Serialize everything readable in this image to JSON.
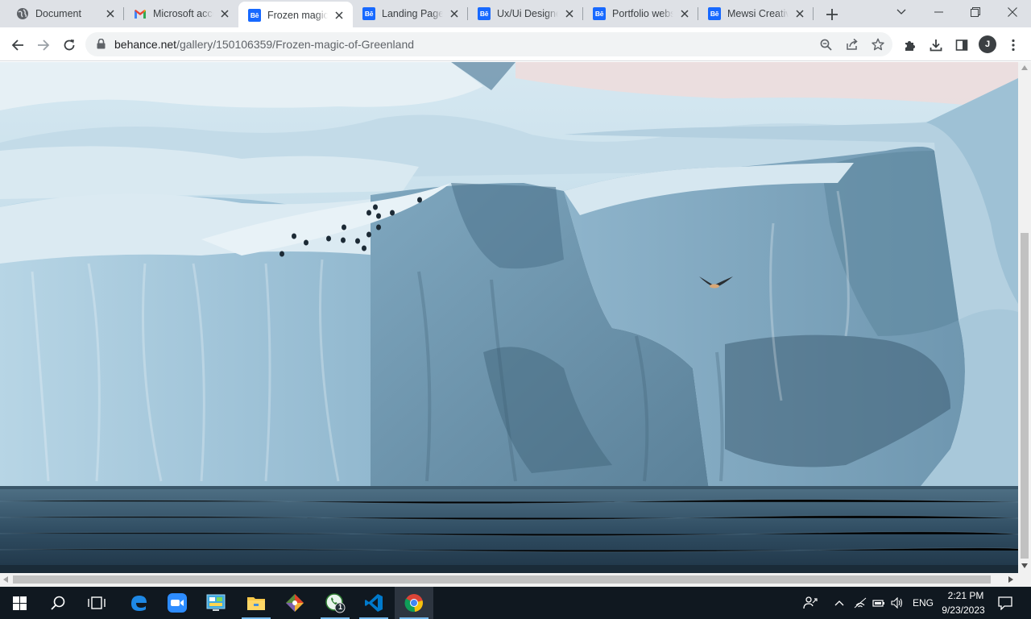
{
  "browser": {
    "tabs": [
      {
        "title": "Document",
        "icon": "globe-icon",
        "active": false
      },
      {
        "title": "Microsoft acco",
        "icon": "gmail-icon",
        "active": false
      },
      {
        "title": "Frozen magic o",
        "icon": "behance-icon",
        "active": true
      },
      {
        "title": "Landing Page -",
        "icon": "behance-icon",
        "active": false
      },
      {
        "title": "Ux/Ui Designer",
        "icon": "behance-icon",
        "active": false
      },
      {
        "title": "Portfolio websi",
        "icon": "behance-icon",
        "active": false
      },
      {
        "title": "Mewsi Creative",
        "icon": "behance-icon",
        "active": false
      }
    ],
    "behance_favicon_text": "Bē",
    "url_host": "behance.net",
    "url_path": "/gallery/150106359/Frozen-magic-of-Greenland",
    "profile_initial": "J",
    "accent_color": "#1769ff"
  },
  "page": {
    "image_subject": "iceberg-photo"
  },
  "taskbar": {
    "apps": [
      {
        "name": "start",
        "icon": "windows-start-icon"
      },
      {
        "name": "search",
        "icon": "search-icon"
      },
      {
        "name": "task-view",
        "icon": "task-view-icon"
      },
      {
        "name": "edge",
        "icon": "edge-icon"
      },
      {
        "name": "zoom",
        "icon": "zoom-icon"
      },
      {
        "name": "control-panel",
        "icon": "control-panel-icon"
      },
      {
        "name": "file-explorer",
        "icon": "folder-icon"
      },
      {
        "name": "git",
        "icon": "git-icon"
      },
      {
        "name": "whatsapp",
        "icon": "whatsapp-icon"
      },
      {
        "name": "vscode",
        "icon": "vscode-icon"
      },
      {
        "name": "chrome",
        "icon": "chrome-icon"
      }
    ],
    "whatsapp_badge": "1",
    "language": "ENG",
    "time": "2:21 PM",
    "date": "9/23/2023"
  }
}
